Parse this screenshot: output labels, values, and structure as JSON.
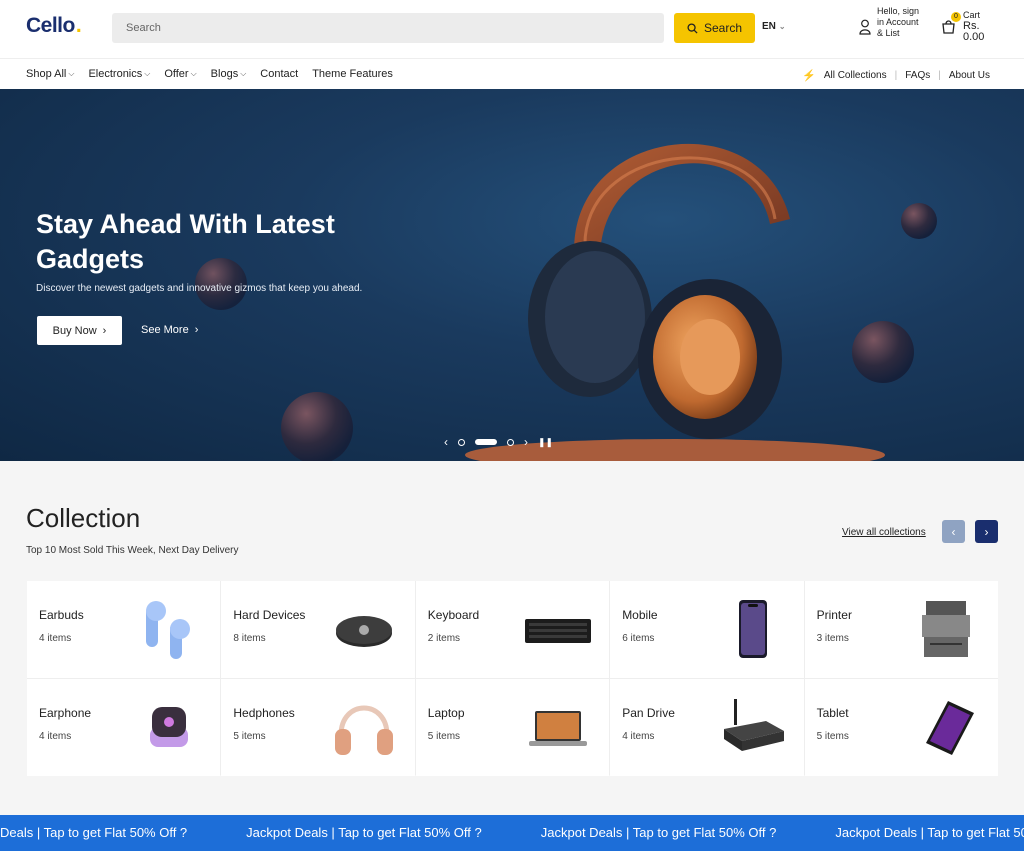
{
  "header": {
    "logo_text": "Cello",
    "logo_dot": ".",
    "search_placeholder": "Search",
    "search_button": "Search",
    "language": "EN",
    "account_text": "Hello, sign in Account & List",
    "cart_label": "Cart",
    "cart_amount": "Rs. 0.00",
    "cart_count": "0"
  },
  "nav": {
    "items": [
      {
        "label": "Shop All",
        "dropdown": true
      },
      {
        "label": "Electronics",
        "dropdown": true
      },
      {
        "label": "Offer",
        "dropdown": true
      },
      {
        "label": "Blogs",
        "dropdown": true
      },
      {
        "label": "Contact",
        "dropdown": false
      },
      {
        "label": "Theme Features",
        "dropdown": false
      }
    ],
    "right": [
      "All Collections",
      "FAQs",
      "About Us"
    ]
  },
  "hero": {
    "title": "Stay Ahead With Latest Gadgets",
    "subtitle": "Discover the newest gadgets and innovative gizmos that keep you ahead.",
    "buy_button": "Buy Now",
    "see_more": "See More",
    "slide_index": 2,
    "slide_count": 3
  },
  "collection": {
    "title": "Collection",
    "subtitle": "Top 10 Most Sold This Week, Next Day Delivery",
    "view_all": "View all collections",
    "items": [
      {
        "name": "Earbuds",
        "count": "4 items",
        "icon": "earbuds-icon"
      },
      {
        "name": "Hard Devices",
        "count": "8 items",
        "icon": "hard-device-icon"
      },
      {
        "name": "Keyboard",
        "count": "2 items",
        "icon": "keyboard-icon"
      },
      {
        "name": "Mobile",
        "count": "6 items",
        "icon": "mobile-icon"
      },
      {
        "name": "Printer",
        "count": "3 items",
        "icon": "printer-icon"
      },
      {
        "name": "Earphone",
        "count": "4 items",
        "icon": "earphone-icon"
      },
      {
        "name": "Hedphones",
        "count": "5 items",
        "icon": "headphones-icon"
      },
      {
        "name": "Laptop",
        "count": "5 items",
        "icon": "laptop-icon"
      },
      {
        "name": "Pan Drive",
        "count": "4 items",
        "icon": "pan-drive-icon"
      },
      {
        "name": "Tablet",
        "count": "5 items",
        "icon": "tablet-icon"
      }
    ]
  },
  "marquee": {
    "text": "Jackpot Deals | Tap to get Flat 50% Off ?",
    "first_fragment": "Deals | Tap to get Flat 50% Off ?"
  },
  "colors": {
    "brand": "#1a2e6e",
    "accent": "#f5c400",
    "marquee": "#1d6ed8",
    "hero_bg": "#1a3a5e"
  }
}
